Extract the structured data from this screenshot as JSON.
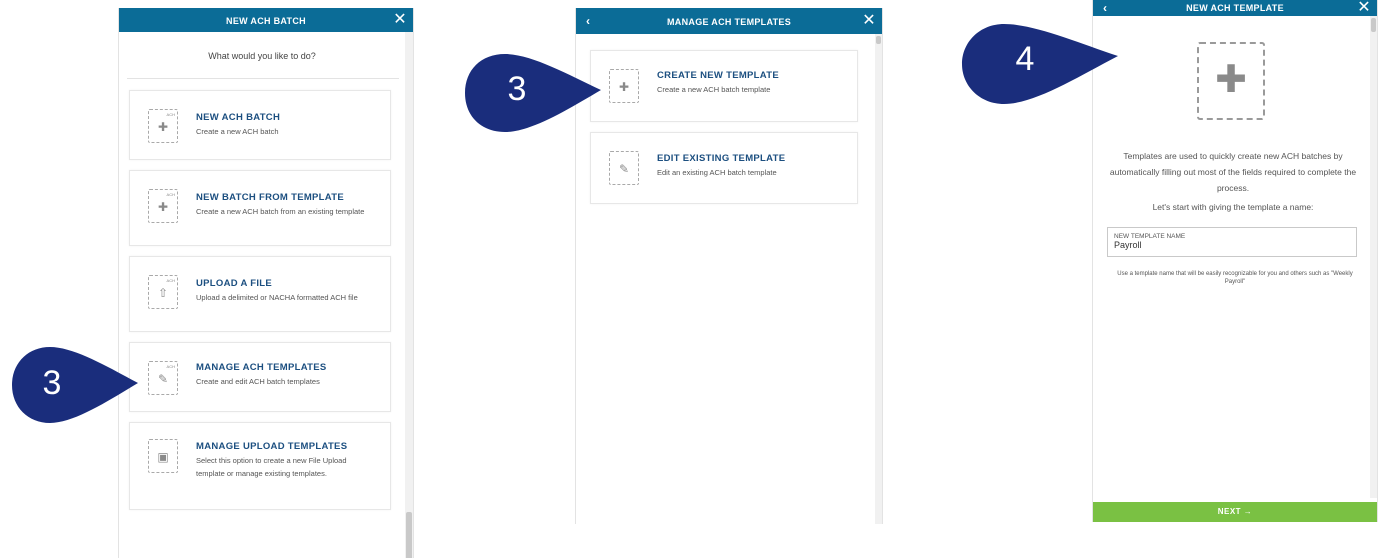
{
  "panel1": {
    "title": "NEW ACH BATCH",
    "close_icon": "close-icon",
    "prompt": "What would you like to do?",
    "options": [
      {
        "title": "NEW ACH BATCH",
        "desc": "Create a new ACH batch",
        "tag": "ACH",
        "icon": "plus-icon"
      },
      {
        "title": "NEW BATCH FROM TEMPLATE",
        "desc": "Create a new ACH batch from an existing template",
        "tag": "ACH",
        "icon": "plus-icon"
      },
      {
        "title": "UPLOAD A FILE",
        "desc": "Upload a delimited or NACHA formatted ACH file",
        "tag": "ACH",
        "icon": "upload-arrow-icon"
      },
      {
        "title": "MANAGE ACH TEMPLATES",
        "desc": "Create and edit ACH batch templates",
        "tag": "ACH",
        "icon": "pencil-icon"
      },
      {
        "title": "MANAGE UPLOAD TEMPLATES",
        "desc": "Select this option to create a new File Upload template or manage existing templates.",
        "tag": "",
        "icon": "file-pencil-icon"
      }
    ]
  },
  "panel2": {
    "title": "MANAGE ACH TEMPLATES",
    "back_icon": "chevron-left-icon",
    "close_icon": "close-icon",
    "options": [
      {
        "title": "CREATE NEW TEMPLATE",
        "desc": "Create a new ACH batch template",
        "icon": "plus-icon"
      },
      {
        "title": "EDIT EXISTING TEMPLATE",
        "desc": "Edit an existing ACH batch template",
        "icon": "pencil-icon"
      }
    ]
  },
  "panel3": {
    "title": "NEW ACH TEMPLATE",
    "back_icon": "chevron-left-icon",
    "close_icon": "close-icon",
    "intro": "Templates are used to quickly create new ACH batches by automatically filling out most of the fields required to complete the process.",
    "instruction": "Let's start with giving the template a name:",
    "field_label": "NEW TEMPLATE NAME",
    "field_value": "Payroll",
    "hint": "Use a template name that will be easily recognizable for you and others such as \"Weekly Payroll\"",
    "next_label": "NEXT →"
  },
  "callouts": [
    {
      "number": "3"
    },
    {
      "number": "3"
    },
    {
      "number": "4"
    }
  ],
  "colors": {
    "header": "#0b6c97",
    "callout": "#1a2d7c",
    "title_text": "#1c4f80",
    "next_button": "#7ac143"
  }
}
